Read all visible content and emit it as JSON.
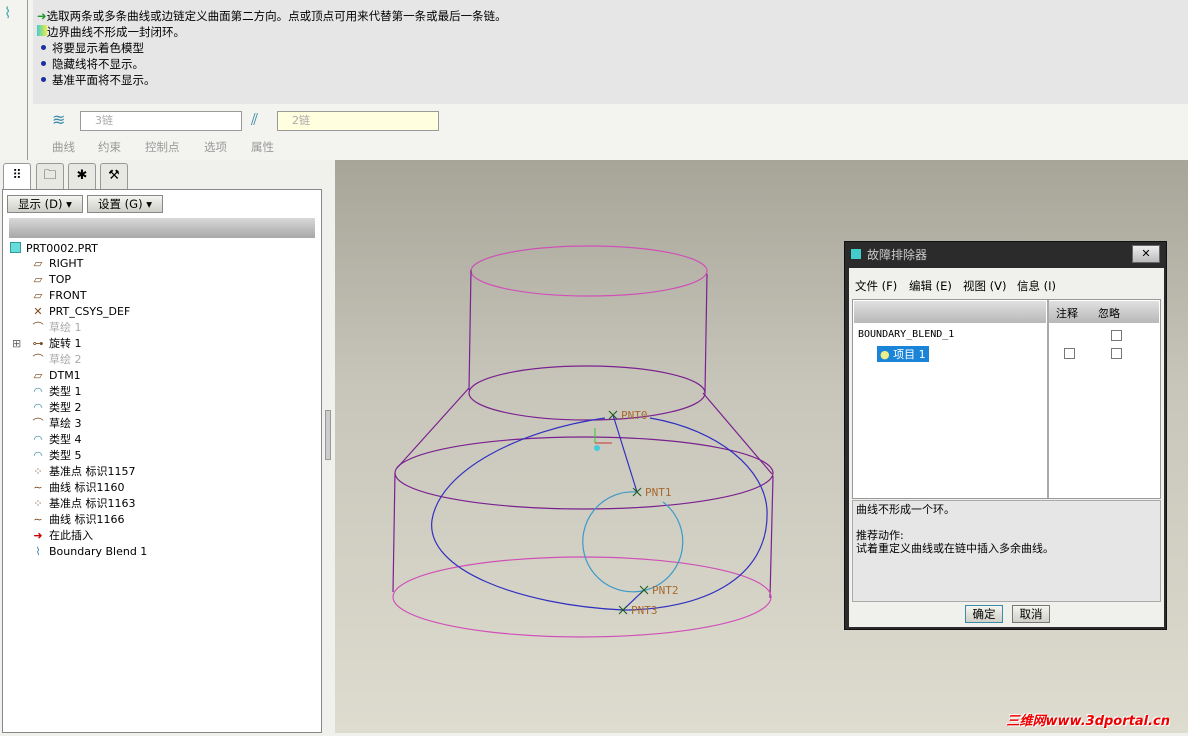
{
  "messages": {
    "line1": "选取两条或多条曲线或边链定义曲面第二方向。点或顶点可用来代替第一条或最后一条链。",
    "line2": "边界曲线不形成一封闭环。",
    "bullets": [
      "将要显示着色模型",
      "隐藏线将不显示。",
      "基准平面将不显示。"
    ]
  },
  "dashboard": {
    "first_direction": "3链",
    "second_direction": "2链",
    "tabs": [
      "曲线",
      "约束",
      "控制点",
      "选项",
      "属性"
    ]
  },
  "navigator": {
    "show_menu": "显示 (D) ▾",
    "settings_menu": "设置 (G) ▾",
    "root": "PRT0002.PRT",
    "items": [
      {
        "label": "RIGHT",
        "icon": "datum-plane-icon"
      },
      {
        "label": "TOP",
        "icon": "datum-plane-icon"
      },
      {
        "label": "FRONT",
        "icon": "datum-plane-icon"
      },
      {
        "label": "PRT_CSYS_DEF",
        "icon": "csys-icon"
      },
      {
        "label": "草绘 1",
        "icon": "sketch-icon",
        "dim": true
      },
      {
        "label": "旋转 1",
        "icon": "revolve-icon",
        "expandable": true
      },
      {
        "label": "草绘 2",
        "icon": "sketch-icon",
        "dim": true
      },
      {
        "label": "DTM1",
        "icon": "datum-plane-icon"
      },
      {
        "label": "类型 1",
        "icon": "surface-icon"
      },
      {
        "label": "类型 2",
        "icon": "surface-icon"
      },
      {
        "label": "草绘 3",
        "icon": "sketch-icon"
      },
      {
        "label": "类型 4",
        "icon": "surface-icon"
      },
      {
        "label": "类型 5",
        "icon": "surface-icon"
      },
      {
        "label": "基准点 标识1157",
        "icon": "datum-point-icon"
      },
      {
        "label": "曲线 标识1160",
        "icon": "curve-icon"
      },
      {
        "label": "基准点 标识1163",
        "icon": "datum-point-icon"
      },
      {
        "label": "曲线 标识1166",
        "icon": "curve-icon"
      },
      {
        "label": "在此插入",
        "icon": "insert-here-arrow-icon"
      },
      {
        "label": "Boundary Blend 1",
        "icon": "boundary-blend-icon"
      }
    ]
  },
  "viewport": {
    "points": [
      "PNT0",
      "PNT1",
      "PNT2",
      "PNT3"
    ]
  },
  "troubleshooter": {
    "title": "故障排除器",
    "menus": [
      "文件 (F)",
      "编辑 (E)",
      "视图 (V)",
      "信息 (I)"
    ],
    "col_note": "注释",
    "col_ignore": "忽略",
    "root": "BOUNDARY_BLEND_1",
    "item": "项目 1",
    "message": "曲线不形成一个环。",
    "action_title": "推荐动作:",
    "action": "试着重定义曲线或在链中插入多余曲线。",
    "ok": "确定",
    "cancel": "取消"
  },
  "watermark": "三维网www.3dportal.cn"
}
